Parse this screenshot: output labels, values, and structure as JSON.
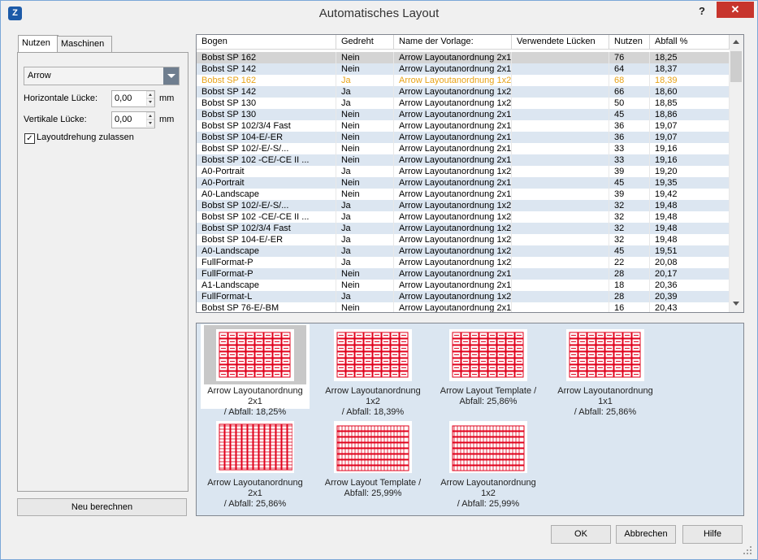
{
  "window": {
    "title": "Automatisches Layout",
    "help": "?",
    "close": "✕"
  },
  "left": {
    "tabs": [
      "Nutzen",
      "Maschinen"
    ],
    "template": "Arrow",
    "h_gap_label": "Horizontale Lücke:",
    "h_gap_value": "0,00",
    "v_gap_label": "Vertikale Lücke:",
    "v_gap_value": "0,00",
    "unit": "mm",
    "rotation_label": "Layoutdrehung zulassen",
    "rotation_checked": true,
    "recalc": "Neu berechnen"
  },
  "table": {
    "columns": [
      "Bogen",
      "Gedreht",
      "Name der Vorlage:",
      "Verwendete Lücken",
      "Nutzen",
      "Abfall %"
    ],
    "rows": [
      [
        "Bobst SP 162",
        "Nein",
        "Arrow Layoutanordnung 2x1",
        "",
        "76",
        "18,25"
      ],
      [
        "Bobst SP 142",
        "Nein",
        "Arrow Layoutanordnung 2x1",
        "",
        "64",
        "18,37"
      ],
      [
        "Bobst SP 162",
        "Ja",
        "Arrow Layoutanordnung 1x2",
        "",
        "68",
        "18,39"
      ],
      [
        "Bobst SP 142",
        "Ja",
        "Arrow Layoutanordnung 1x2",
        "",
        "66",
        "18,60"
      ],
      [
        "Bobst SP 130",
        "Ja",
        "Arrow Layoutanordnung 1x2",
        "",
        "50",
        "18,85"
      ],
      [
        "Bobst SP 130",
        "Nein",
        "Arrow Layoutanordnung 2x1",
        "",
        "45",
        "18,86"
      ],
      [
        "Bobst SP 102/3/4 Fast",
        "Nein",
        "Arrow Layoutanordnung 2x1",
        "",
        "36",
        "19,07"
      ],
      [
        "Bobst SP 104-E/-ER",
        "Nein",
        "Arrow Layoutanordnung 2x1",
        "",
        "36",
        "19,07"
      ],
      [
        "Bobst SP 102/-E/-S/...",
        "Nein",
        "Arrow Layoutanordnung 2x1",
        "",
        "33",
        "19,16"
      ],
      [
        "Bobst SP 102 -CE/-CE II ...",
        "Nein",
        "Arrow Layoutanordnung 2x1",
        "",
        "33",
        "19,16"
      ],
      [
        "A0-Portrait",
        "Ja",
        "Arrow Layoutanordnung 1x2",
        "",
        "39",
        "19,20"
      ],
      [
        "A0-Portrait",
        "Nein",
        "Arrow Layoutanordnung 2x1",
        "",
        "45",
        "19,35"
      ],
      [
        "A0-Landscape",
        "Nein",
        "Arrow Layoutanordnung 2x1",
        "",
        "39",
        "19,42"
      ],
      [
        "Bobst SP 102/-E/-S/...",
        "Ja",
        "Arrow Layoutanordnung 1x2",
        "",
        "32",
        "19,48"
      ],
      [
        "Bobst SP 102 -CE/-CE II ...",
        "Ja",
        "Arrow Layoutanordnung 1x2",
        "",
        "32",
        "19,48"
      ],
      [
        "Bobst SP 102/3/4 Fast",
        "Ja",
        "Arrow Layoutanordnung 1x2",
        "",
        "32",
        "19,48"
      ],
      [
        "Bobst SP 104-E/-ER",
        "Ja",
        "Arrow Layoutanordnung 1x2",
        "",
        "32",
        "19,48"
      ],
      [
        "A0-Landscape",
        "Ja",
        "Arrow Layoutanordnung 1x2",
        "",
        "45",
        "19,51"
      ],
      [
        "FullFormat-P",
        "Ja",
        "Arrow Layoutanordnung 1x2",
        "",
        "22",
        "20,08"
      ],
      [
        "FullFormat-P",
        "Nein",
        "Arrow Layoutanordnung 2x1",
        "",
        "28",
        "20,17"
      ],
      [
        "A1-Landscape",
        "Nein",
        "Arrow Layoutanordnung 2x1",
        "",
        "18",
        "20,36"
      ],
      [
        "FullFormat-L",
        "Ja",
        "Arrow Layoutanordnung 1x2",
        "",
        "28",
        "20,39"
      ],
      [
        "Bobst SP 76-E/-BM",
        "Nein",
        "Arrow Layoutanordnung 2x1",
        "",
        "16",
        "20,43"
      ]
    ],
    "row_styles": [
      "selected",
      "alt",
      "highlight",
      "alt",
      "normal",
      "alt",
      "normal",
      "alt",
      "normal",
      "alt",
      "normal",
      "alt",
      "normal",
      "alt",
      "normal",
      "alt",
      "normal",
      "alt",
      "normal",
      "alt",
      "normal",
      "alt",
      "normal"
    ]
  },
  "previews": [
    {
      "line1": "Arrow Layoutanordnung 2x1",
      "line2": "/ Abfall: 18,25%",
      "selected": true,
      "style": "grid2x1"
    },
    {
      "line1": "Arrow Layoutanordnung 1x2",
      "line2": "/ Abfall: 18,39%",
      "selected": false,
      "style": "grid1x2"
    },
    {
      "line1": "Arrow Layout Template /",
      "line2": "Abfall: 25,86%",
      "selected": false,
      "style": "template"
    },
    {
      "line1": "Arrow Layoutanordnung 1x1",
      "line2": "/ Abfall: 25,86%",
      "selected": false,
      "style": "template"
    },
    {
      "line1": "Arrow Layoutanordnung 2x1",
      "line2": "/ Abfall: 25,86%",
      "selected": false,
      "style": "cols"
    },
    {
      "line1": "Arrow Layout Template /",
      "line2": "Abfall: 25,99%",
      "selected": false,
      "style": "rows"
    },
    {
      "line1": "Arrow Layoutanordnung 1x2",
      "line2": "/ Abfall: 25,99%",
      "selected": false,
      "style": "rows"
    }
  ],
  "buttons": {
    "ok": "OK",
    "cancel": "Abbrechen",
    "help": "Hilfe"
  },
  "colors": {
    "accent": "#e0001b",
    "selected_row": "#d4d4d4",
    "alt_row": "#dce6f1",
    "highlight_text": "#e8a317",
    "preview_bg": "#dbe6f1",
    "close": "#c7352d"
  }
}
